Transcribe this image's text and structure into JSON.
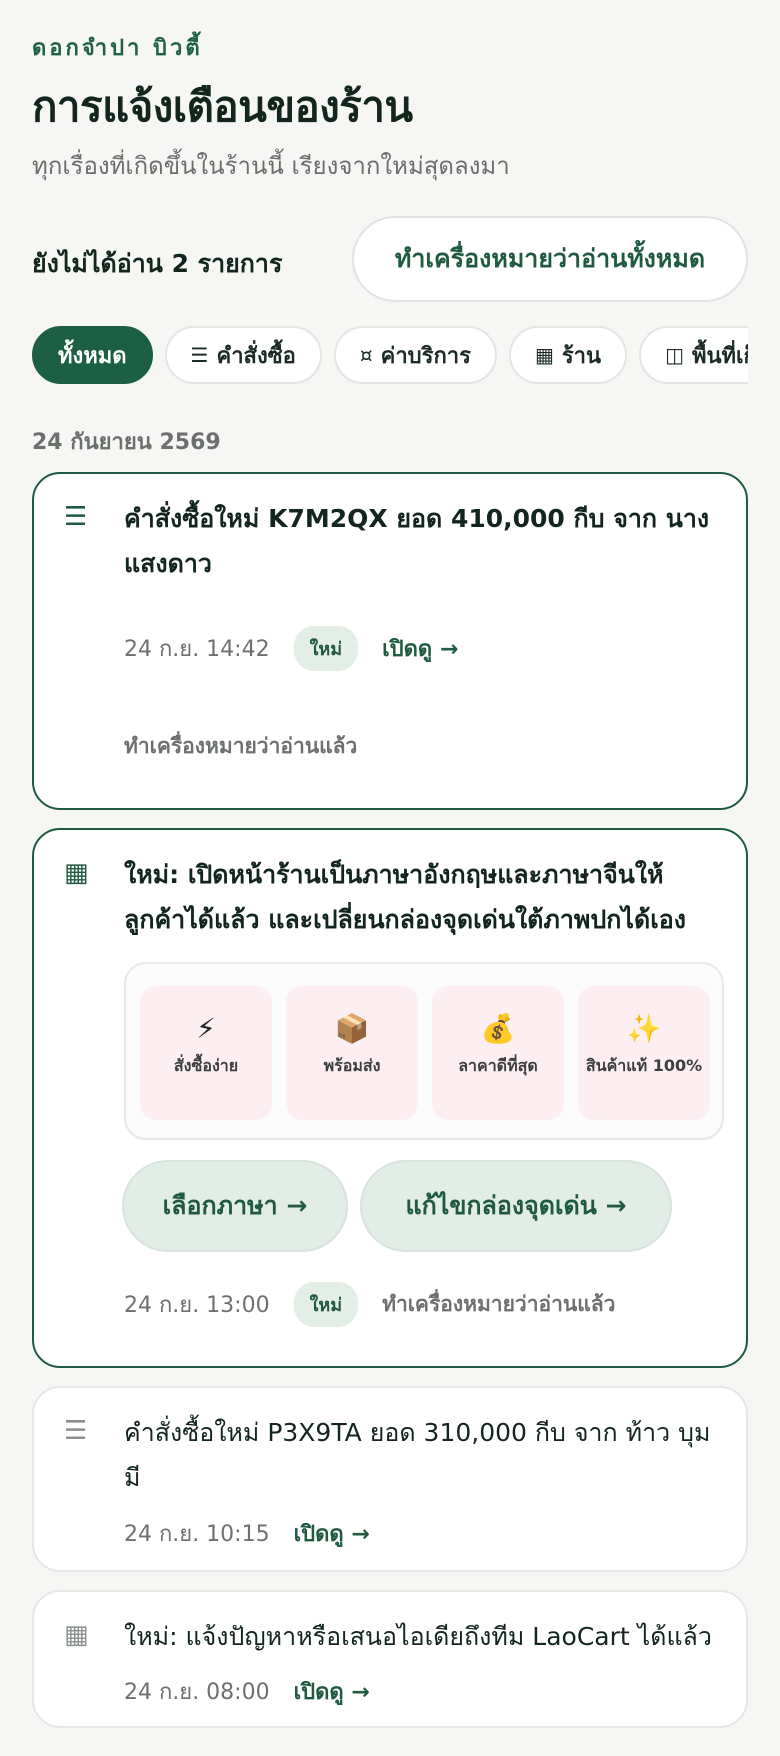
{
  "header": {
    "shop_name": "ดอกจำปา บิวตี้",
    "title": "การแจ้งเตือนของร้าน",
    "subtitle": "ทุกเรื่องที่เกิดขึ้นในร้านนี้ เรียงจากใหม่สุดลงมา"
  },
  "toolbar": {
    "unread_count_text": "ยังไม่ได้อ่าน 2 รายการ",
    "mark_all_label": "ทำเครื่องหมายว่าอ่านทั้งหมด"
  },
  "filters": [
    {
      "icon": "",
      "label": "ทั้งหมด",
      "active": true
    },
    {
      "icon": "☰",
      "label": "คำสั่งซื้อ"
    },
    {
      "icon": "¤",
      "label": "ค่าบริการ"
    },
    {
      "icon": "▦",
      "label": "ร้าน"
    },
    {
      "icon": "◫",
      "label": "พื้นที่เก็บ"
    }
  ],
  "date_heading": "24 กันยายน 2569",
  "notifications": [
    {
      "icon": "list-icon",
      "title": "คำสั่งซื้อใหม่ K7M2QX ยอด 410,000 กีบ จาก นาง แสงดาว",
      "time": "24 ก.ย. 14:42",
      "badge": "ใหม่",
      "open_label": "เปิดดู →",
      "mark_read_label": "ทำเครื่องหมายว่าอ่านแล้ว"
    },
    {
      "icon": "store-grid-icon",
      "title": "ใหม่: เปิดหน้าร้านเป็นภาษาอังกฤษและภาษาจีนให้ลูกค้าได้แล้ว และเปลี่ยนกล่องจุดเด่นใต้ภาพปกได้เอง",
      "preview_tiles": [
        {
          "icon": "⚡",
          "label": "สั่งซื้อง่าย"
        },
        {
          "icon": "📦",
          "label": "พร้อมส่ง"
        },
        {
          "icon": "💰",
          "label": "ลาคาดีที่สุด"
        },
        {
          "icon": "✨",
          "label": "สินค้าแท้ 100%"
        }
      ],
      "action_1": "เลือกภาษา →",
      "action_2": "แก้ไขกล่องจุดเด่น →",
      "time": "24 ก.ย. 13:00",
      "badge": "ใหม่",
      "mark_read_label": "ทำเครื่องหมายว่าอ่านแล้ว"
    },
    {
      "icon": "list-icon",
      "title": "คำสั่งซื้อใหม่ P3X9TA ยอด 310,000 กีบ จาก ท้าว บุมมี",
      "time": "24 ก.ย. 10:15",
      "open_label": "เปิดดู →"
    },
    {
      "icon": "store-grid-icon",
      "title": "ใหม่: แจ้งปัญหาหรือเสนอไอเดียถึงทีม LaoCart ได้แล้ว",
      "time": "24 ก.ย. 08:00",
      "open_label": "เปิดดู →"
    }
  ]
}
